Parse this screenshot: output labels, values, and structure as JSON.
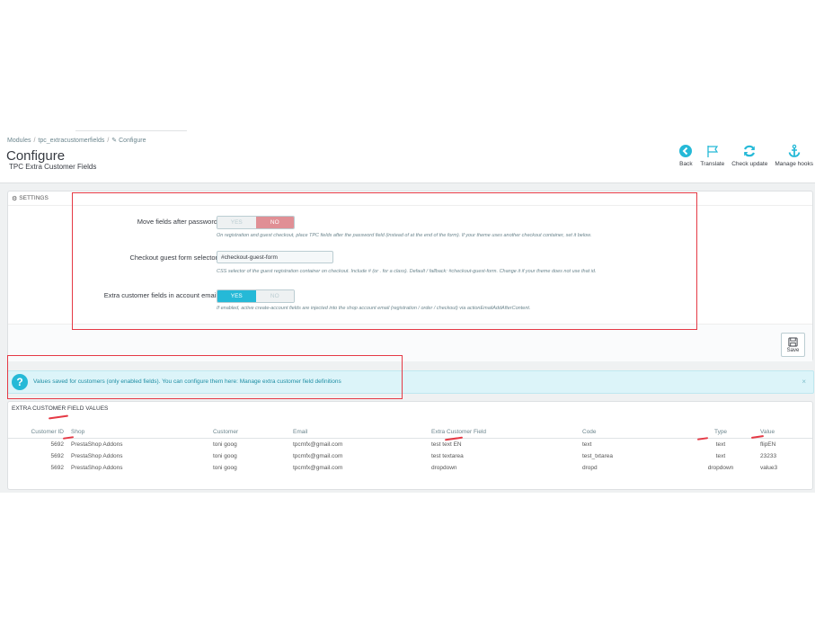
{
  "breadcrumb": [
    "Modules",
    "tpc_extracustomerfields",
    "Configure"
  ],
  "page": {
    "title": "Configure",
    "subtitle": "TPC Extra Customer Fields"
  },
  "toolbar": {
    "back": "Back",
    "translate": "Translate",
    "check_update": "Check update",
    "manage_hooks": "Manage hooks"
  },
  "settings": {
    "heading": "SETTINGS",
    "move_fields": {
      "label": "Move fields after password",
      "yes": "YES",
      "no": "NO",
      "value": "NO",
      "help": "On registration and guest checkout, place TPC fields after the password field (instead of at the end of the form). If your theme uses another checkout container, set it below."
    },
    "guest_selector": {
      "label": "Checkout guest form selector",
      "value": "#checkout-guest-form",
      "help": "CSS selector of the guest registration container on checkout. Include # (or . for a class). Default / fallback: #checkout-guest-form. Change it if your theme does not use that id."
    },
    "account_email": {
      "label": "Extra customer fields in account email",
      "yes": "YES",
      "no": "NO",
      "value": "YES",
      "help": "If enabled, active create-account fields are injected into the shop account email (registration / order / checkout) via actionEmailAddAfterContent."
    },
    "save_label": "Save"
  },
  "alert": {
    "text": "Values saved for customers (only enabled fields). You can configure them here:",
    "link": "Manage extra customer field definitions",
    "close": "×"
  },
  "values": {
    "heading": "EXTRA CUSTOMER FIELD VALUES",
    "columns": {
      "customer_id": "Customer ID",
      "shop": "Shop",
      "customer": "Customer",
      "email": "Email",
      "field": "Extra Customer Field",
      "code": "Code",
      "type": "Type",
      "value": "Value"
    },
    "rows": [
      {
        "customer_id": "5692",
        "shop": "PrestaShop Addons",
        "customer": "toni goog",
        "email": "tpcmfx@gmail.com",
        "field": "test text EN",
        "code": "text",
        "type": "text",
        "value": "flipEN"
      },
      {
        "customer_id": "5692",
        "shop": "PrestaShop Addons",
        "customer": "toni goog",
        "email": "tpcmfx@gmail.com",
        "field": "test textarea",
        "code": "test_txtarea",
        "type": "text",
        "value": "23233"
      },
      {
        "customer_id": "5692",
        "shop": "PrestaShop Addons",
        "customer": "toni goog",
        "email": "tpcmfx@gmail.com",
        "field": "dropdown",
        "code": "dropd",
        "type": "dropdown",
        "value": "value3"
      }
    ]
  },
  "colors": {
    "accent": "#25b9d7",
    "danger": "#e08f95",
    "annotation": "#e53945"
  }
}
